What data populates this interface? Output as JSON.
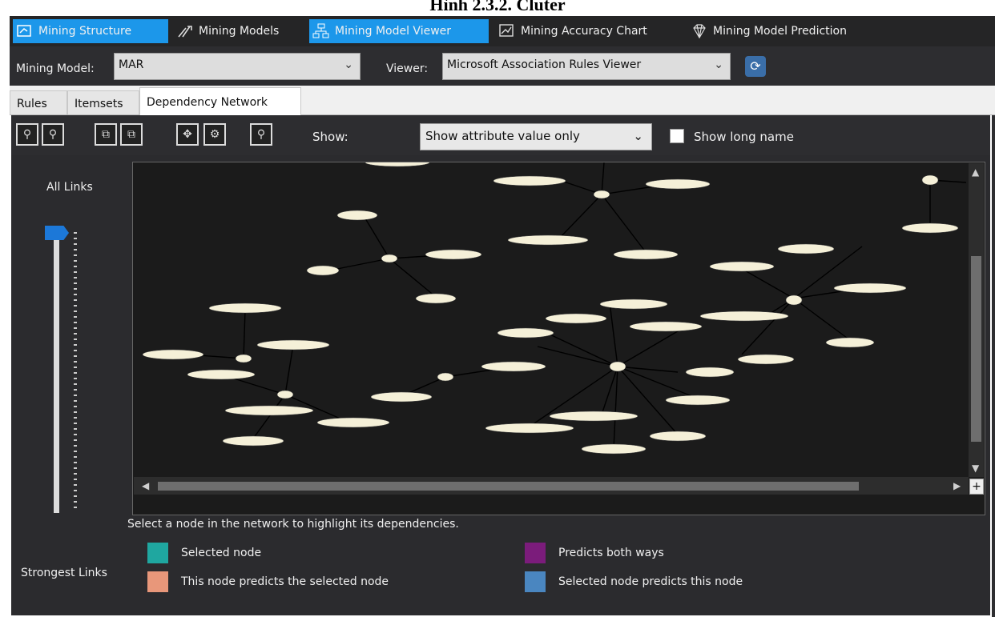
{
  "caption": "Hình 2.3.2. Cluter",
  "ribbon": {
    "tabs": [
      {
        "label": "Mining Structure",
        "active": true
      },
      {
        "label": "Mining Models",
        "active": false
      },
      {
        "label": "Mining Model Viewer",
        "active": true
      },
      {
        "label": "Mining Accuracy Chart",
        "active": false
      },
      {
        "label": "Mining Model Prediction",
        "active": false
      }
    ]
  },
  "model_row": {
    "mining_model_label": "Mining Model:",
    "mining_model_value": "MAR",
    "viewer_label": "Viewer:",
    "viewer_value": "Microsoft Association Rules Viewer"
  },
  "subtabs": [
    {
      "label": "Rules",
      "active": false
    },
    {
      "label": "Itemsets",
      "active": false
    },
    {
      "label": "Dependency Network",
      "active": true
    }
  ],
  "toolbar": {
    "show_label": "Show:",
    "show_value": "Show attribute value only",
    "show_long_name_label": "Show long name",
    "show_long_name_checked": false
  },
  "slider": {
    "label": "All Links",
    "level": 1.0
  },
  "instruction": "Select a node in the network to highlight its dependencies.",
  "legend": {
    "title": "Strongest Links",
    "items": [
      {
        "label": "Selected node",
        "color": "#1fa7a0"
      },
      {
        "label": "This node predicts the selected node",
        "color": "#e8977a"
      },
      {
        "label": "Predicts both ways",
        "color": "#7b1c7b"
      },
      {
        "label": "Selected node predicts this node",
        "color": "#4a86c0"
      }
    ]
  },
  "colors": {
    "accent": "#1c97ea",
    "node_fill": "#f5f0d8",
    "background": "#2d2d30"
  }
}
